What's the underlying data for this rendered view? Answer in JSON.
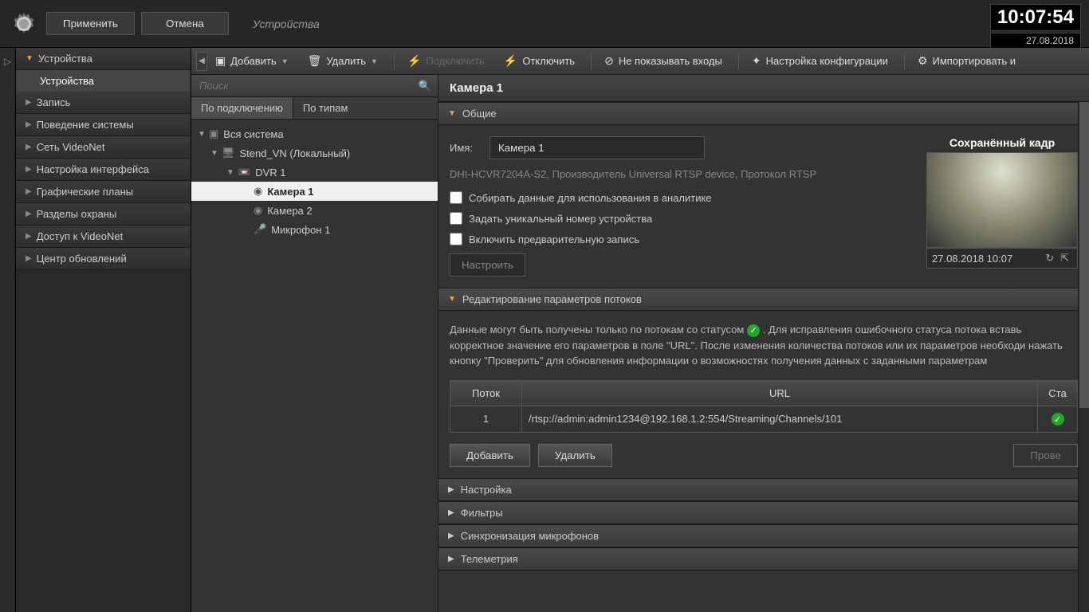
{
  "header": {
    "apply": "Применить",
    "cancel": "Отмена",
    "title": "Устройства",
    "time": "10:07:54",
    "date": "27.08.2018"
  },
  "sidebar": {
    "items": [
      {
        "label": "Устройства",
        "expanded": true,
        "children": [
          {
            "label": "Устройства"
          }
        ]
      },
      {
        "label": "Запись"
      },
      {
        "label": "Поведение системы"
      },
      {
        "label": "Сеть VideoNet"
      },
      {
        "label": "Настройка интерфейса"
      },
      {
        "label": "Графические планы"
      },
      {
        "label": "Разделы охраны"
      },
      {
        "label": "Доступ к VideoNet"
      },
      {
        "label": "Центр обновлений"
      }
    ]
  },
  "toolbar": {
    "add": "Добавить",
    "delete": "Удалить",
    "connect": "Подключить",
    "disconnect": "Отключить",
    "hide_inputs": "Не показывать входы",
    "config": "Настройка конфигурации",
    "import": "Импортировать и"
  },
  "tree": {
    "search_placeholder": "Поиск",
    "tabs": {
      "by_connection": "По подключению",
      "by_type": "По типам"
    },
    "root": "Вся система",
    "server": "Stend_VN (Локальный)",
    "dvr": "DVR 1",
    "camera1": "Камера 1",
    "camera2": "Камера 2",
    "mic1": "Микрофон 1"
  },
  "detail": {
    "title": "Камера 1",
    "sections": {
      "general": "Общие",
      "streams": "Редактирование параметров потоков",
      "settings": "Настройка",
      "filters": "Фильтры",
      "mic_sync": "Синхронизация микрофонов",
      "telemetry": "Телеметрия"
    },
    "general": {
      "name_label": "Имя:",
      "name_value": "Камера 1",
      "device_info": "DHI-HCVR7204A-S2, Производитель Universal RTSP device, Протокол RTSP",
      "check_analytics": "Собирать данные для использования в аналитике",
      "check_unique_id": "Задать уникальный номер устройства",
      "check_prerecord": "Включить предварительную запись",
      "configure_btn": "Настроить",
      "preview_title": "Сохранённый кадр",
      "preview_date": "27.08.2018 10:07"
    },
    "streams": {
      "help1": "Данные могут быть получены только по потокам со статусом",
      "help2": ". Для исправления ошибочного статуса потока вставь корректное значение его параметров в поле \"URL\". После изменения количества потоков или их параметров необходи нажать кнопку \"Проверить\" для обновления информации о возможностях получения данных с заданными параметрам",
      "col_stream": "Поток",
      "col_url": "URL",
      "col_status": "Ста",
      "row_num": "1",
      "row_url": "/rtsp://admin:admin1234@192.168.1.2:554/Streaming/Channels/101",
      "add_btn": "Добавить",
      "delete_btn": "Удалить",
      "verify_btn": "Прове"
    }
  }
}
